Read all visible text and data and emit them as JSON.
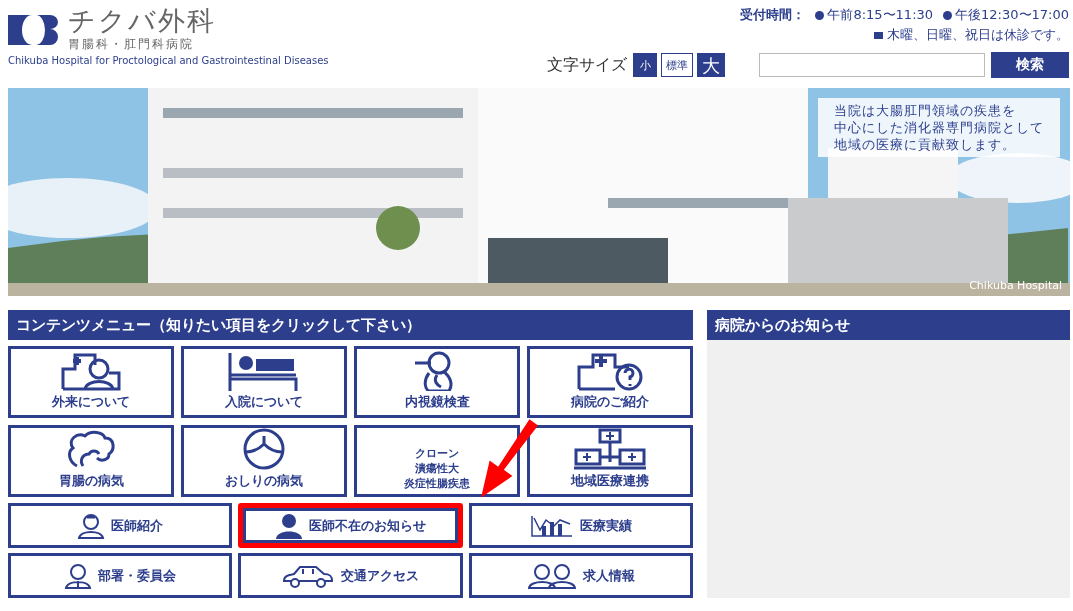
{
  "header": {
    "logo_title": "チクバ外科",
    "logo_subtitle": "胃腸科・肛門科病院",
    "logo_english": "Chikuba Hospital for Proctological and Gastrointestinal Diseases",
    "hours_label": "受付時間：",
    "hours": [
      "午前8:15〜11:30",
      "午後12:30〜17:00"
    ],
    "closed_note": "木曜、日曜、祝日は休診です。",
    "font_size_label": "文字サイズ",
    "font_sizes": [
      {
        "label": "小",
        "selected": false
      },
      {
        "label": "標準",
        "selected": true
      },
      {
        "label": "大",
        "selected": false
      }
    ],
    "search_button": "検索"
  },
  "banner": {
    "kind": "picture",
    "caption": [
      "当院は大腸肛門領域の疾患を",
      "中心にした消化器専門病院として",
      "地域の医療に貢献致します。"
    ],
    "credit": "Chikuba Hospital"
  },
  "menu": {
    "title": "コンテンツメニュー（知りたい項目をクリックして下さい）",
    "tiles": [
      {
        "lines": [
          "外来について"
        ]
      },
      {
        "lines": [
          "入院について"
        ]
      },
      {
        "lines": [
          "内視鏡検査"
        ]
      },
      {
        "lines": [
          "病院のご紹介"
        ]
      },
      {
        "lines": [
          "胃腸の病気"
        ]
      },
      {
        "lines": [
          "おしりの病気"
        ]
      },
      {
        "lines": [
          "クローン",
          "潰瘍性大",
          "炎症性腸疾患"
        ]
      },
      {
        "lines": [
          "地域医療連携"
        ]
      }
    ],
    "links": [
      {
        "label": "医師紹介",
        "highlighted": false
      },
      {
        "label": "医師不在のお知らせ",
        "highlighted": true
      },
      {
        "label": "医療実績",
        "highlighted": false
      },
      {
        "label": "部署・委員会",
        "highlighted": false
      },
      {
        "label": "交通アクセス",
        "highlighted": false
      },
      {
        "label": "求人情報",
        "highlighted": false
      }
    ]
  },
  "notices": {
    "title": "病院からのお知らせ"
  }
}
